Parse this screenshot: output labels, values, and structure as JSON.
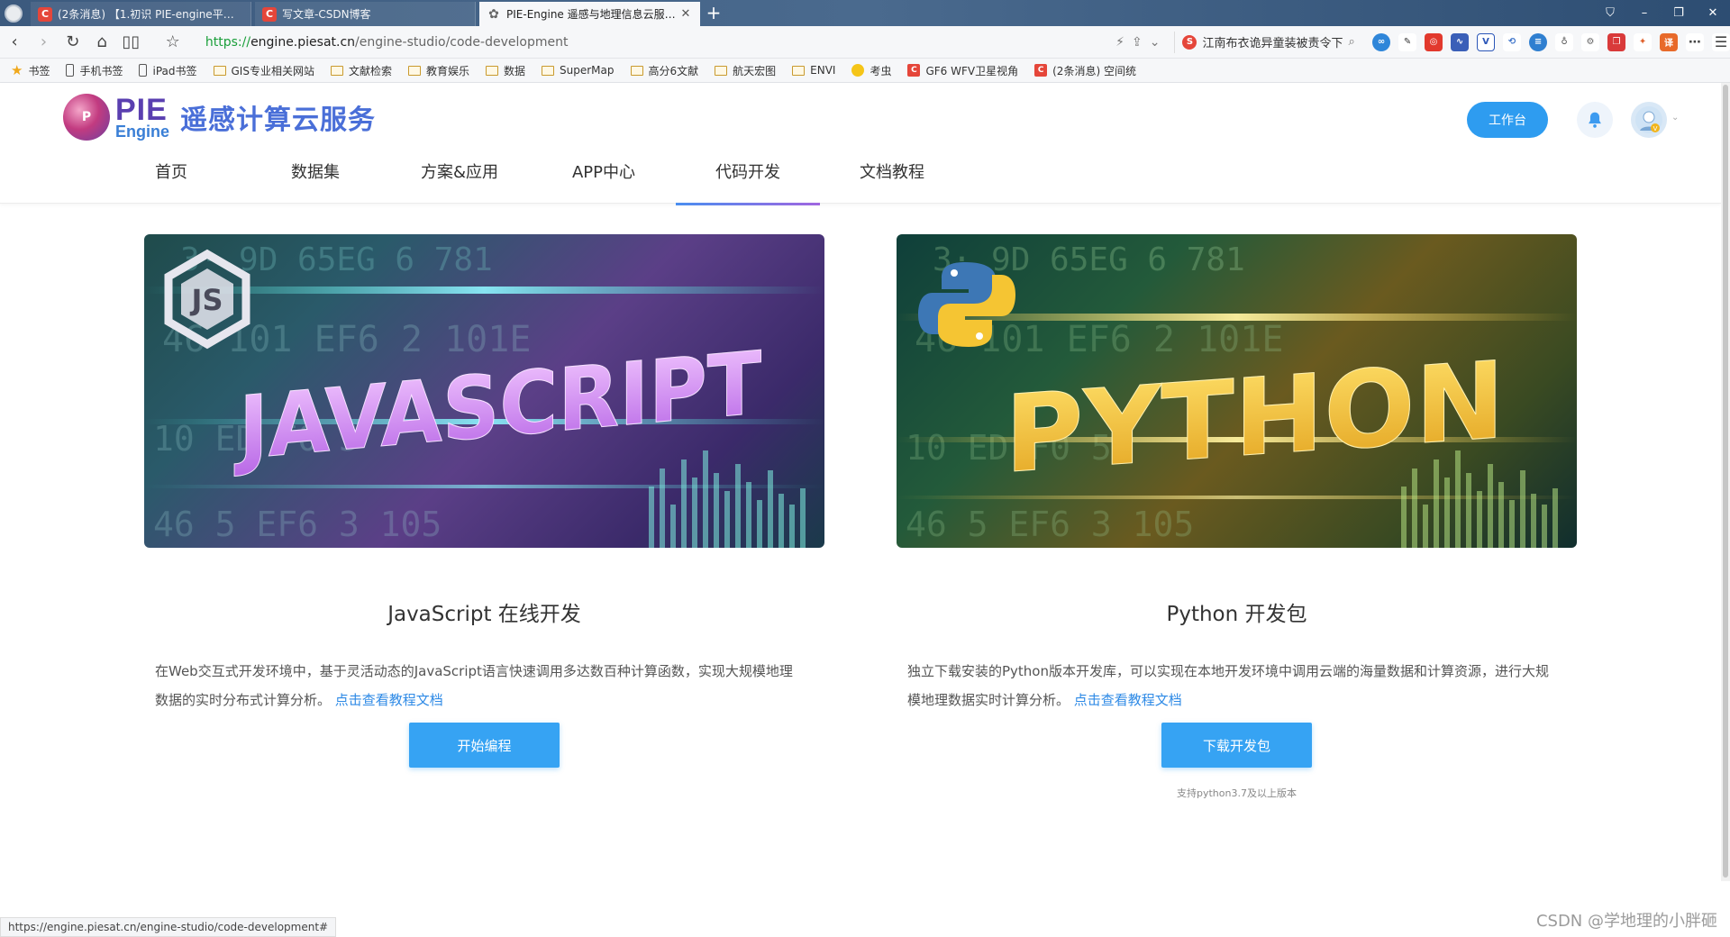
{
  "browser": {
    "tabs": [
      {
        "title": "(2条消息) 【1.初识 PIE-engine平台】",
        "icon": "csdn-icon"
      },
      {
        "title": "写文章-CSDN博客",
        "icon": "csdn-icon"
      },
      {
        "title": "PIE-Engine 遥感与地理信息云服务平",
        "icon": "pie-icon",
        "active": true
      }
    ],
    "url_scheme": "https://",
    "url_host": "engine.piesat.cn",
    "url_path": "/engine-studio/code-development",
    "search_text": "江南布衣诡异童装被责令下",
    "bookmarks": [
      {
        "label": "书签",
        "icon": "star-icon"
      },
      {
        "label": "手机书签",
        "icon": "phone-icon"
      },
      {
        "label": "iPad书签",
        "icon": "tablet-icon"
      },
      {
        "label": "GIS专业相关网站",
        "icon": "folder-icon"
      },
      {
        "label": "文献检索",
        "icon": "folder-icon"
      },
      {
        "label": "教育娱乐",
        "icon": "folder-icon"
      },
      {
        "label": "数据",
        "icon": "folder-icon"
      },
      {
        "label": "SuperMap",
        "icon": "folder-icon"
      },
      {
        "label": "高分6文献",
        "icon": "folder-icon"
      },
      {
        "label": "航天宏图",
        "icon": "folder-icon"
      },
      {
        "label": "ENVI",
        "icon": "folder-icon"
      },
      {
        "label": "考虫",
        "icon": "smile-icon"
      },
      {
        "label": "GF6 WFV卫星视角",
        "icon": "csdn-icon"
      },
      {
        "label": "(2条消息) 空间统",
        "icon": "csdn-icon"
      }
    ],
    "status_url": "https://engine.piesat.cn/engine-studio/code-development#"
  },
  "site": {
    "logo_pie": "PIE",
    "logo_engine": "Engine",
    "logo_cn": "遥感计算云服务",
    "workbench_label": "工作台",
    "nav": [
      {
        "label": "首页"
      },
      {
        "label": "数据集"
      },
      {
        "label": "方案&应用"
      },
      {
        "label": "APP中心"
      },
      {
        "label": "代码开发",
        "active": true
      },
      {
        "label": "文档教程"
      }
    ]
  },
  "cards": [
    {
      "banner_word": "JAVASCRIPT",
      "banner_badge": "JS",
      "title": "JavaScript 在线开发",
      "desc": "在Web交互式开发环境中，基于灵活动态的JavaScript语言快速调用多达数百种计算函数，实现大规模地理数据的实时分布式计算分析。",
      "link": "点击查看教程文档",
      "button": "开始编程"
    },
    {
      "banner_word": "PYTHON",
      "title": "Python 开发包",
      "desc": "独立下载安装的Python版本开发库，可以实现在本地开发环境中调用云端的海量数据和计算资源，进行大规模地理数据实时计算分析。",
      "link": "点击查看教程文档",
      "button": "下载开发包",
      "note": "支持python3.7及以上版本"
    }
  ],
  "watermark": "CSDN @学地理的小胖砸",
  "colors": {
    "accent": "#36a3f3",
    "link": "#2e8ae6",
    "nav_underline_start": "#4a8ef0",
    "nav_underline_end": "#a066e0"
  }
}
